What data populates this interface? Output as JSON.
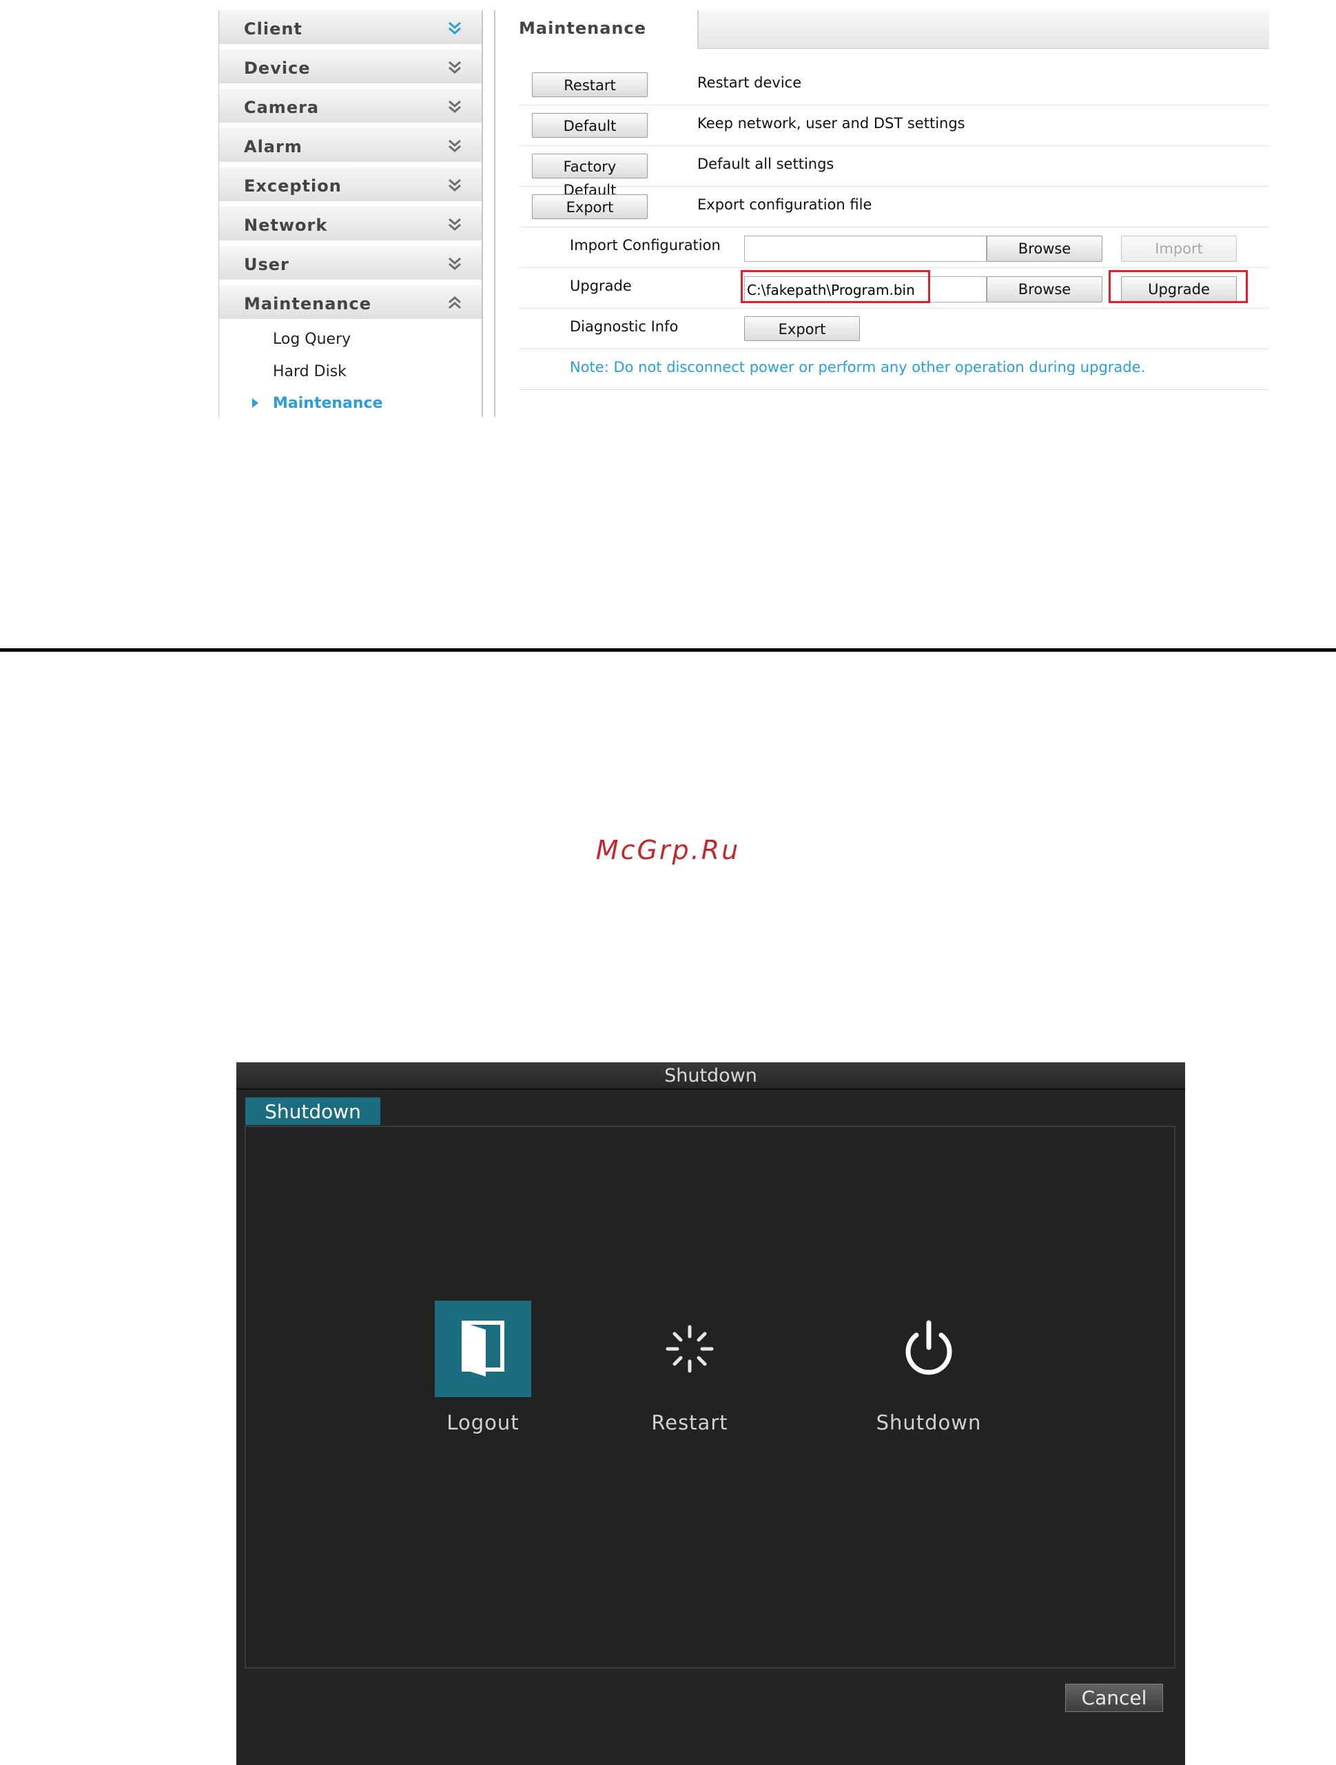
{
  "sidebar": {
    "items": [
      {
        "label": "Client",
        "expanded": false
      },
      {
        "label": "Device",
        "expanded": false
      },
      {
        "label": "Camera",
        "expanded": false
      },
      {
        "label": "Alarm",
        "expanded": false
      },
      {
        "label": "Exception",
        "expanded": false
      },
      {
        "label": "Network",
        "expanded": false
      },
      {
        "label": "User",
        "expanded": false
      },
      {
        "label": "Maintenance",
        "expanded": true
      }
    ],
    "submenu": [
      {
        "label": "Log Query",
        "active": false
      },
      {
        "label": "Hard Disk",
        "active": false
      },
      {
        "label": "Maintenance",
        "active": true
      }
    ]
  },
  "content": {
    "tab_label": "Maintenance",
    "restart": {
      "button": "Restart",
      "desc": "Restart device"
    },
    "default": {
      "button": "Default",
      "desc": "Keep network, user and DST settings"
    },
    "factory_default": {
      "button": "Factory Default",
      "desc": "Default all settings"
    },
    "export_config": {
      "button": "Export",
      "desc": "Export configuration file"
    },
    "import_config": {
      "label": "Import Configuration",
      "value": "",
      "browse": "Browse",
      "action": "Import",
      "action_enabled": false
    },
    "upgrade": {
      "label": "Upgrade",
      "value": "C:\\fakepath\\Program.bin",
      "browse": "Browse",
      "action": "Upgrade",
      "highlighted": true
    },
    "diagnostic": {
      "label": "Diagnostic Info",
      "button": "Export"
    },
    "note": "Note: Do not disconnect power or perform any other operation during upgrade."
  },
  "watermark": "McGrp.Ru",
  "nvr": {
    "title": "Shutdown",
    "tab": "Shutdown",
    "options": [
      {
        "label": "Logout",
        "icon": "logout-door-icon",
        "selected": true
      },
      {
        "label": "Restart",
        "icon": "restart-spinner-icon",
        "selected": false
      },
      {
        "label": "Shutdown",
        "icon": "power-icon",
        "selected": false
      }
    ],
    "cancel": "Cancel"
  },
  "colors": {
    "accent_blue": "#2b9fd6",
    "highlight_red": "#e0202a",
    "nvr_teal": "#1b6e80",
    "watermark_red": "#c1272d"
  }
}
